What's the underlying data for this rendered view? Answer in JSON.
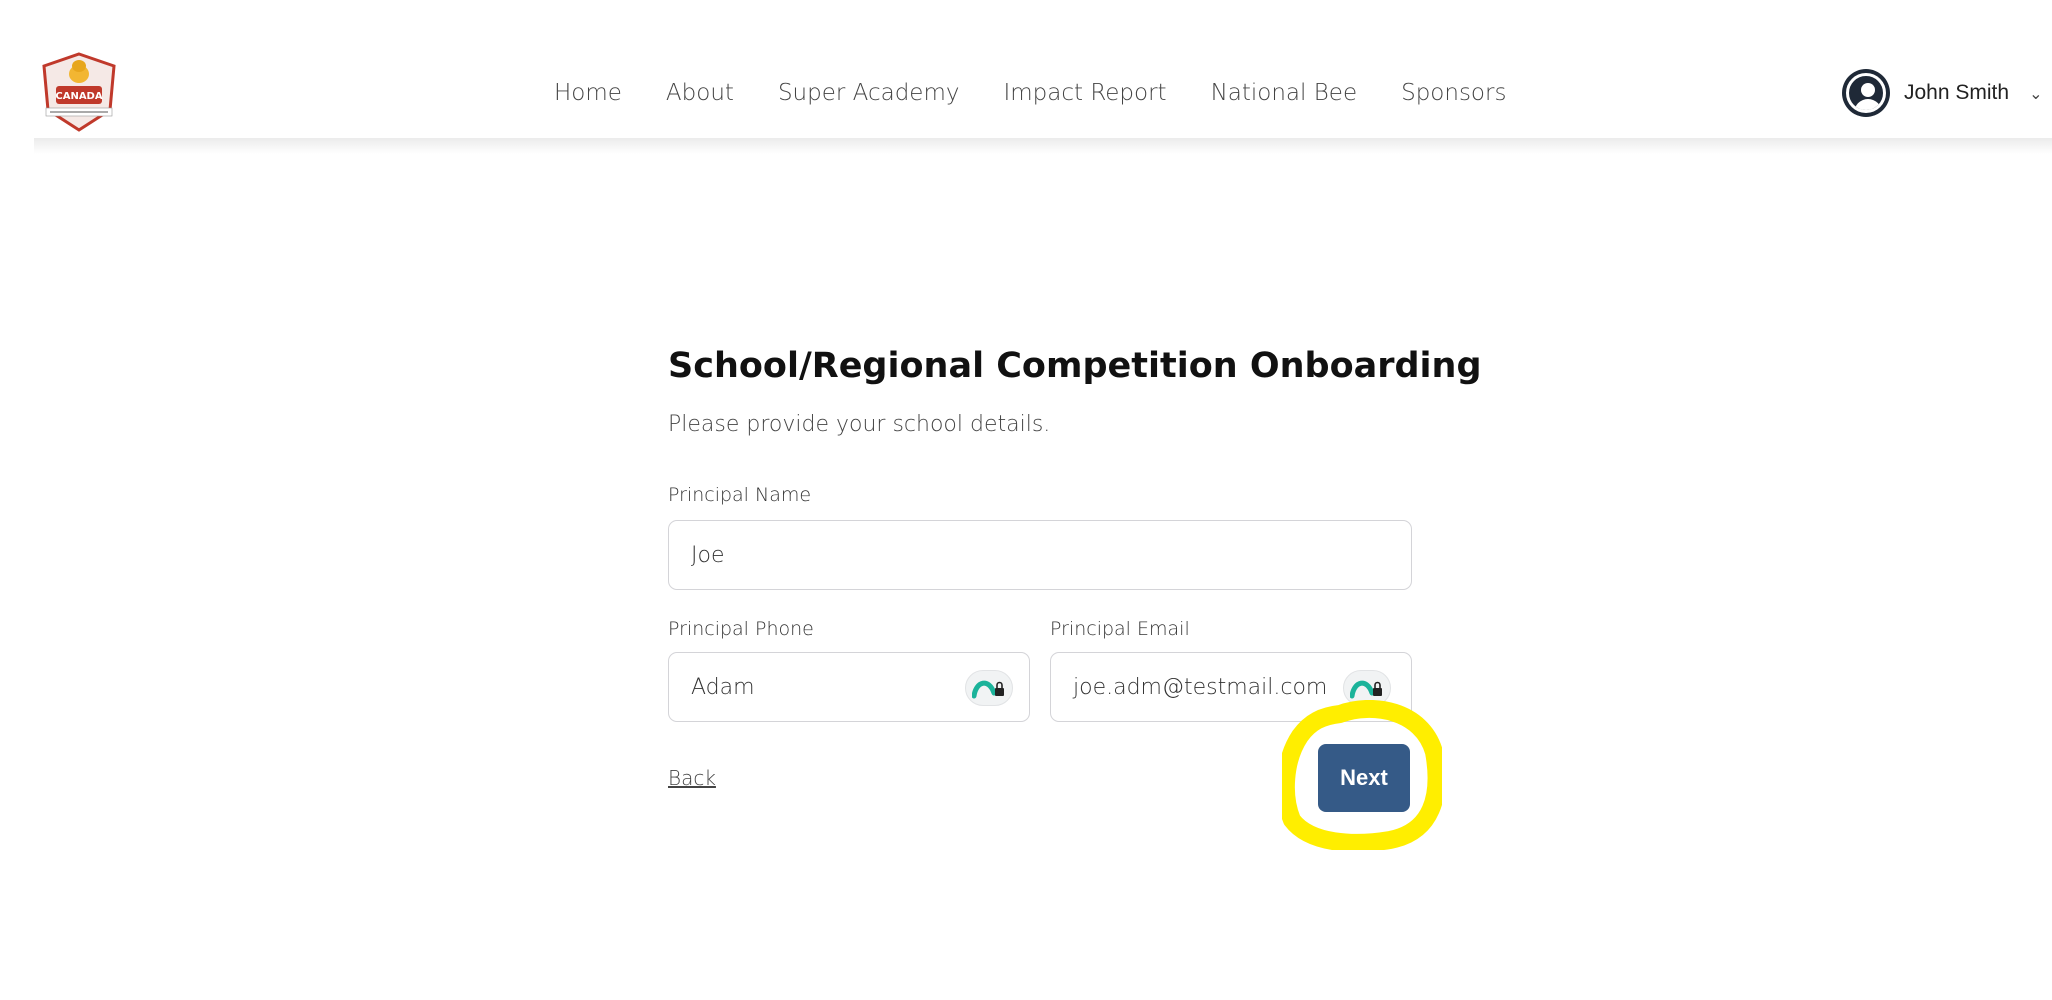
{
  "header": {
    "logo_icon": "canada-spelling-bee-logo",
    "nav": [
      {
        "label": "Home"
      },
      {
        "label": "About"
      },
      {
        "label": "Super Academy"
      },
      {
        "label": "Impact Report"
      },
      {
        "label": "National Bee"
      },
      {
        "label": "Sponsors"
      }
    ],
    "user": {
      "name": "John Smith",
      "avatar_icon": "user-avatar-icon",
      "menu_icon": "chevron-down-icon"
    }
  },
  "form": {
    "title": "School/Regional Competition Onboarding",
    "subtitle": "Please provide your school details.",
    "principal_name": {
      "label": "Principal Name",
      "value": "Joe"
    },
    "principal_phone": {
      "label": "Principal Phone",
      "value": "Adam"
    },
    "principal_email": {
      "label": "Principal Email",
      "value": "joe.adm@testmail.com"
    },
    "back_label": "Back",
    "next_label": "Next"
  },
  "colors": {
    "primary_button": "#355a87",
    "highlight": "#ffee00",
    "password_manager": "#1bb39a"
  }
}
